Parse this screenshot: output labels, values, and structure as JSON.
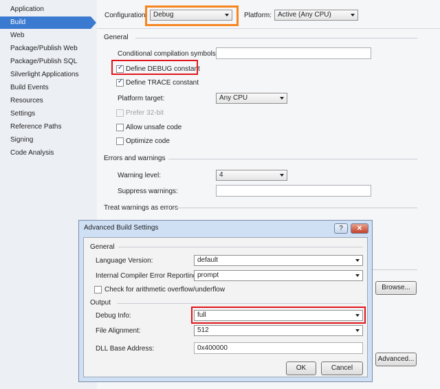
{
  "sidebar": {
    "items": [
      {
        "label": "Application"
      },
      {
        "label": "Build"
      },
      {
        "label": "Web"
      },
      {
        "label": "Package/Publish Web"
      },
      {
        "label": "Package/Publish SQL"
      },
      {
        "label": "Silverlight Applications"
      },
      {
        "label": "Build Events"
      },
      {
        "label": "Resources"
      },
      {
        "label": "Settings"
      },
      {
        "label": "Reference Paths"
      },
      {
        "label": "Signing"
      },
      {
        "label": "Code Analysis"
      }
    ],
    "active": "Build"
  },
  "toolbar": {
    "configuration_label": "Configuration:",
    "configuration_value": "Debug",
    "platform_label": "Platform:",
    "platform_value": "Active (Any CPU)"
  },
  "general": {
    "heading": "General",
    "conditional_label": "Conditional compilation symbols:",
    "conditional_value": "",
    "define_debug": "Define DEBUG constant",
    "define_trace": "Define TRACE constant",
    "platform_target_label": "Platform target:",
    "platform_target_value": "Any CPU",
    "prefer32": "Prefer 32-bit",
    "allow_unsafe": "Allow unsafe code",
    "optimize": "Optimize code"
  },
  "errors": {
    "heading": "Errors and warnings",
    "warning_level_label": "Warning level:",
    "warning_level_value": "4",
    "suppress_label": "Suppress warnings:",
    "suppress_value": ""
  },
  "treat_warnings": {
    "heading": "Treat warnings as errors"
  },
  "buttons": {
    "browse": "Browse...",
    "advanced": "Advanced..."
  },
  "dialog": {
    "title": "Advanced Build Settings",
    "help": "?",
    "close": "✕",
    "general_heading": "General",
    "language_label": "Language Version:",
    "language_value": "default",
    "error_reporting_label": "Internal Compiler Error Reporting:",
    "error_reporting_value": "prompt",
    "overflow_label": "Check for arithmetic overflow/underflow",
    "output_heading": "Output",
    "debug_info_label": "Debug Info:",
    "debug_info_value": "full",
    "file_alignment_label": "File Alignment:",
    "file_alignment_value": "512",
    "dll_base_label": "DLL Base Address:",
    "dll_base_value": "0x400000",
    "ok": "OK",
    "cancel": "Cancel"
  },
  "colors": {
    "accent": "#3a7ad0",
    "highlight_red": "#e1141b",
    "highlight_orange": "#f6851f",
    "dialog_frame": "#cfe0f5"
  }
}
